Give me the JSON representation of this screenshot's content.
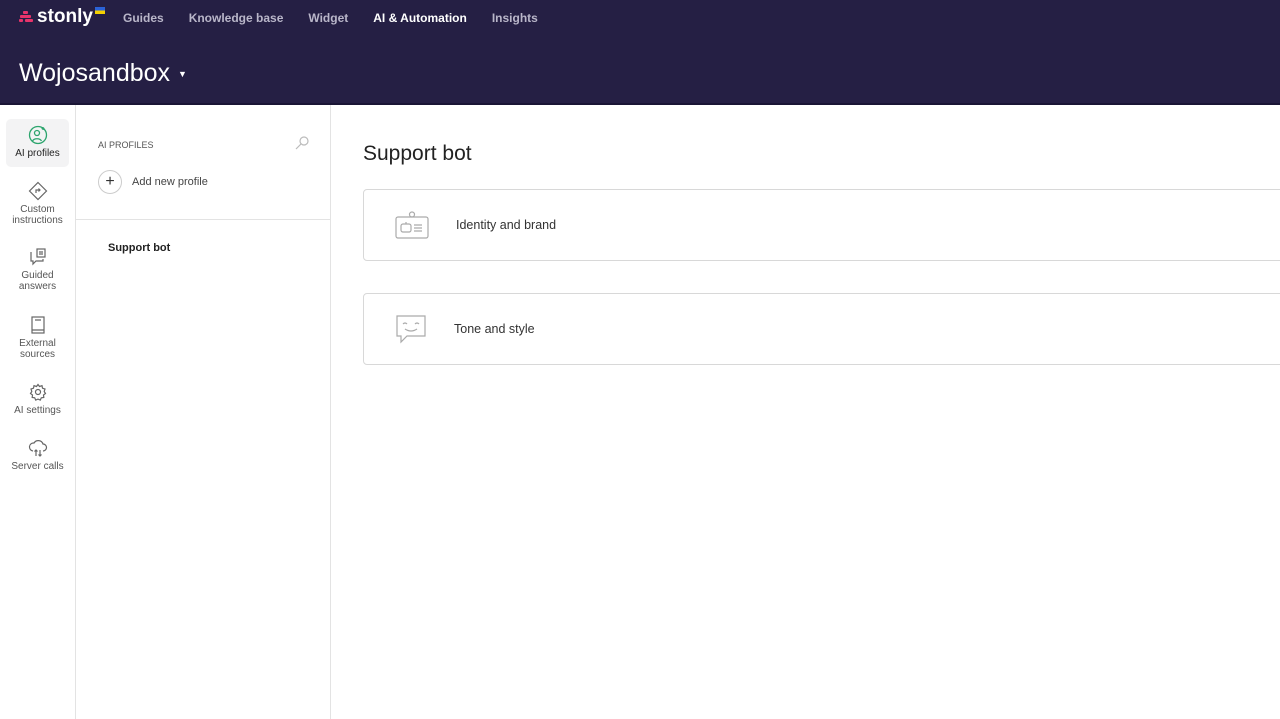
{
  "brand": {
    "name": "stonly"
  },
  "nav": {
    "items": [
      "Guides",
      "Knowledge base",
      "Widget",
      "AI & Automation",
      "Insights"
    ],
    "active": "AI & Automation"
  },
  "workspace": {
    "name": "Wojosandbox"
  },
  "rail": {
    "items": [
      {
        "label": "AI profiles",
        "icon": "ai-profile-icon",
        "active": true
      },
      {
        "label": "Custom instructions",
        "icon": "directions-icon"
      },
      {
        "label": "Guided answers",
        "icon": "chat-doc-icon"
      },
      {
        "label": "External sources",
        "icon": "book-icon"
      },
      {
        "label": "AI settings",
        "icon": "gear-icon"
      },
      {
        "label": "Server calls",
        "icon": "cloud-transfer-icon"
      }
    ]
  },
  "profiles": {
    "header": "AI PROFILES",
    "add_label": "Add new profile",
    "items": [
      "Support bot"
    ]
  },
  "main": {
    "title": "Support bot",
    "cards": [
      {
        "label": "Identity and brand",
        "icon": "badge-robot-icon"
      },
      {
        "label": "Tone and style",
        "icon": "smile-chat-icon"
      }
    ]
  },
  "colors": {
    "header_bg": "#251f44",
    "accent": "#2da56e",
    "brand": "#e8336b"
  }
}
